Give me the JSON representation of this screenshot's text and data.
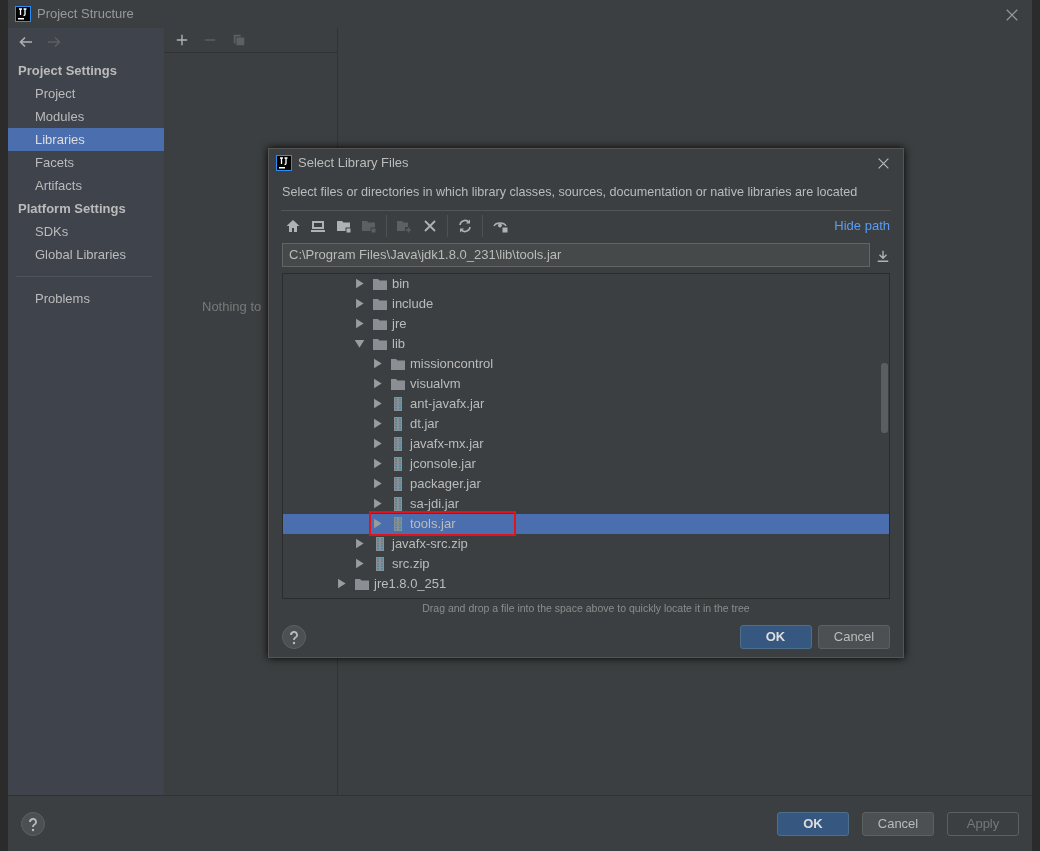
{
  "window": {
    "title": "Project Structure"
  },
  "nav": [
    {
      "kind": "back",
      "disabled": false
    },
    {
      "kind": "forward",
      "disabled": true
    }
  ],
  "sidebar": {
    "items": [
      {
        "kind": "header",
        "label": "Project Settings"
      },
      {
        "kind": "item",
        "label": "Project",
        "selected": false
      },
      {
        "kind": "item",
        "label": "Modules",
        "selected": false
      },
      {
        "kind": "item",
        "label": "Libraries",
        "selected": true
      },
      {
        "kind": "item",
        "label": "Facets",
        "selected": false
      },
      {
        "kind": "item",
        "label": "Artifacts",
        "selected": false
      },
      {
        "kind": "header",
        "label": "Platform Settings"
      },
      {
        "kind": "item",
        "label": "SDKs",
        "selected": false
      },
      {
        "kind": "item",
        "label": "Global Libraries",
        "selected": false
      },
      {
        "kind": "divider"
      },
      {
        "kind": "item",
        "label": "Problems",
        "selected": false
      }
    ]
  },
  "list_toolbar": [
    {
      "kind": "add",
      "disabled": false
    },
    {
      "kind": "remove",
      "disabled": true
    },
    {
      "kind": "copy",
      "disabled": true
    }
  ],
  "list_empty_text": "Nothing to",
  "dialog": {
    "title": "Select Library Files",
    "description": "Select files or directories in which library classes, sources, documentation or native libraries are located",
    "toolbar": [
      {
        "kind": "home",
        "disabled": false
      },
      {
        "kind": "desktop",
        "disabled": false
      },
      {
        "kind": "folder",
        "disabled": false
      },
      {
        "kind": "folder",
        "disabled": true
      },
      {
        "kind": "sep"
      },
      {
        "kind": "new-folder",
        "disabled": true
      },
      {
        "kind": "delete",
        "disabled": false
      },
      {
        "kind": "sep"
      },
      {
        "kind": "refresh",
        "disabled": false
      },
      {
        "kind": "sep"
      },
      {
        "kind": "show-hidden",
        "disabled": false
      }
    ],
    "hide_path_link": "Hide path",
    "path": "C:\\Program Files\\Java\\jdk1.8.0_231\\lib\\tools.jar",
    "tree": {
      "nodes": [
        {
          "children": [
            {
              "label": "bin",
              "kind": "folder",
              "expanded": false,
              "selected": false,
              "highlighted": false
            },
            {
              "label": "include",
              "kind": "folder",
              "expanded": false,
              "selected": false,
              "highlighted": false
            },
            {
              "label": "jre",
              "kind": "folder",
              "expanded": false,
              "selected": false,
              "highlighted": false
            },
            {
              "label": "lib",
              "kind": "folder",
              "expanded": true,
              "selected": false,
              "highlighted": false,
              "children": [
                {
                  "label": "missioncontrol",
                  "kind": "folder",
                  "expanded": false,
                  "selected": false,
                  "highlighted": false
                },
                {
                  "label": "visualvm",
                  "kind": "folder",
                  "expanded": false,
                  "selected": false,
                  "highlighted": false
                },
                {
                  "label": "ant-javafx.jar",
                  "kind": "jar",
                  "expanded": false,
                  "selected": false,
                  "highlighted": false
                },
                {
                  "label": "dt.jar",
                  "kind": "jar",
                  "expanded": false,
                  "selected": false,
                  "highlighted": false
                },
                {
                  "label": "javafx-mx.jar",
                  "kind": "jar",
                  "expanded": false,
                  "selected": false,
                  "highlighted": false
                },
                {
                  "label": "jconsole.jar",
                  "kind": "jar",
                  "expanded": false,
                  "selected": false,
                  "highlighted": false
                },
                {
                  "label": "packager.jar",
                  "kind": "jar",
                  "expanded": false,
                  "selected": false,
                  "highlighted": false
                },
                {
                  "label": "sa-jdi.jar",
                  "kind": "jar",
                  "expanded": false,
                  "selected": false,
                  "highlighted": false
                },
                {
                  "label": "tools.jar",
                  "kind": "jar",
                  "expanded": false,
                  "selected": true,
                  "highlighted": true
                }
              ]
            },
            {
              "label": "javafx-src.zip",
              "kind": "jar",
              "expanded": false,
              "selected": false,
              "highlighted": false
            },
            {
              "label": "src.zip",
              "kind": "jar",
              "expanded": false,
              "selected": false,
              "highlighted": false
            }
          ]
        },
        {
          "label": "jre1.8.0_251",
          "kind": "folder",
          "expanded": false,
          "selected": false,
          "highlighted": false
        }
      ]
    },
    "hint": "Drag and drop a file into the space above to quickly locate it in the tree",
    "buttons": [
      {
        "label": "OK",
        "kind": "primary",
        "disabled": false
      },
      {
        "label": "Cancel",
        "kind": "default",
        "disabled": false
      }
    ]
  },
  "footer_buttons": [
    {
      "label": "OK",
      "kind": "primary",
      "disabled": false
    },
    {
      "label": "Cancel",
      "kind": "default",
      "disabled": false
    },
    {
      "label": "Apply",
      "kind": "default",
      "disabled": true
    }
  ]
}
